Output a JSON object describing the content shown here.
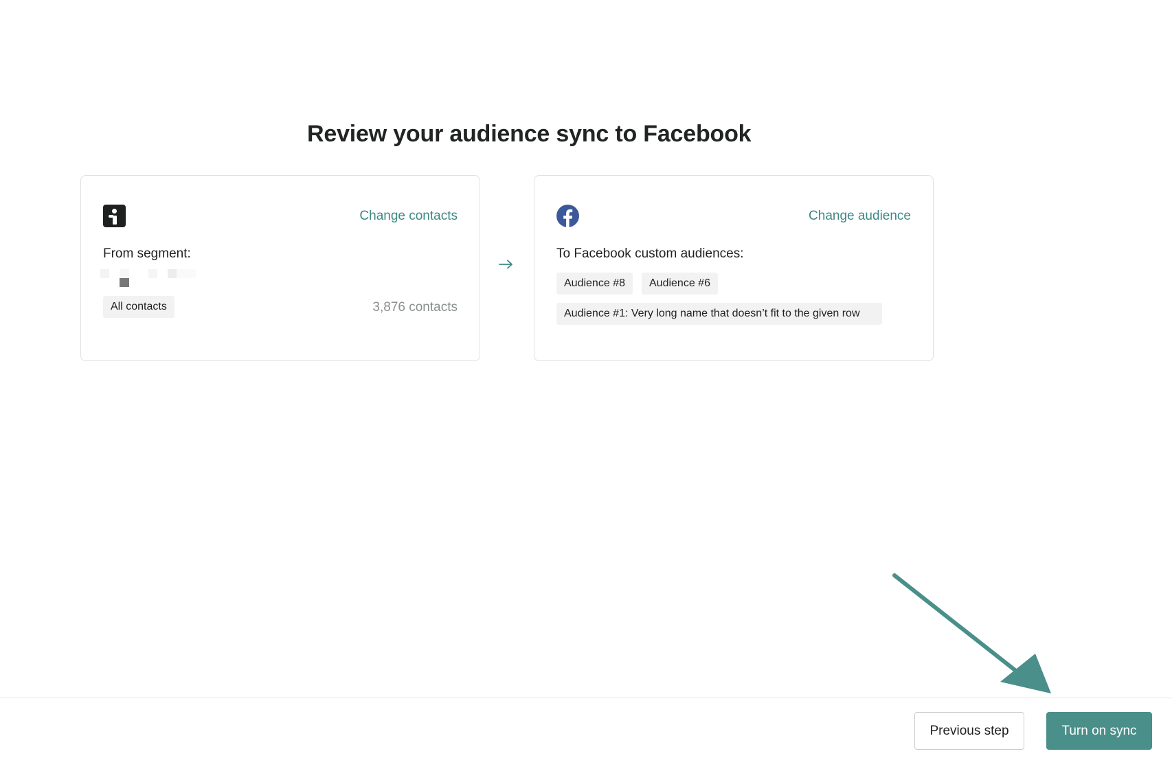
{
  "title": "Review your audience sync to Facebook",
  "source_card": {
    "logo_icon": "omnisend-logo-icon",
    "change_label": "Change contacts",
    "from_label": "From segment:",
    "chip_label": "All contacts",
    "count_label": "3,876 contacts"
  },
  "target_card": {
    "logo_icon": "facebook-logo-icon",
    "change_label": "Change audience",
    "to_label": "To Facebook custom audiences:",
    "audiences": [
      "Audience #8",
      "Audience #6",
      "Audience #1: Very long name that doesn’t fit to the given row"
    ]
  },
  "footer": {
    "previous_label": "Previous step",
    "submit_label": "Turn on sync"
  },
  "colors": {
    "accent": "#3c8983",
    "button_primary": "#4a8f89",
    "facebook": "#3b5998",
    "annotation_arrow": "#4a8f89"
  }
}
